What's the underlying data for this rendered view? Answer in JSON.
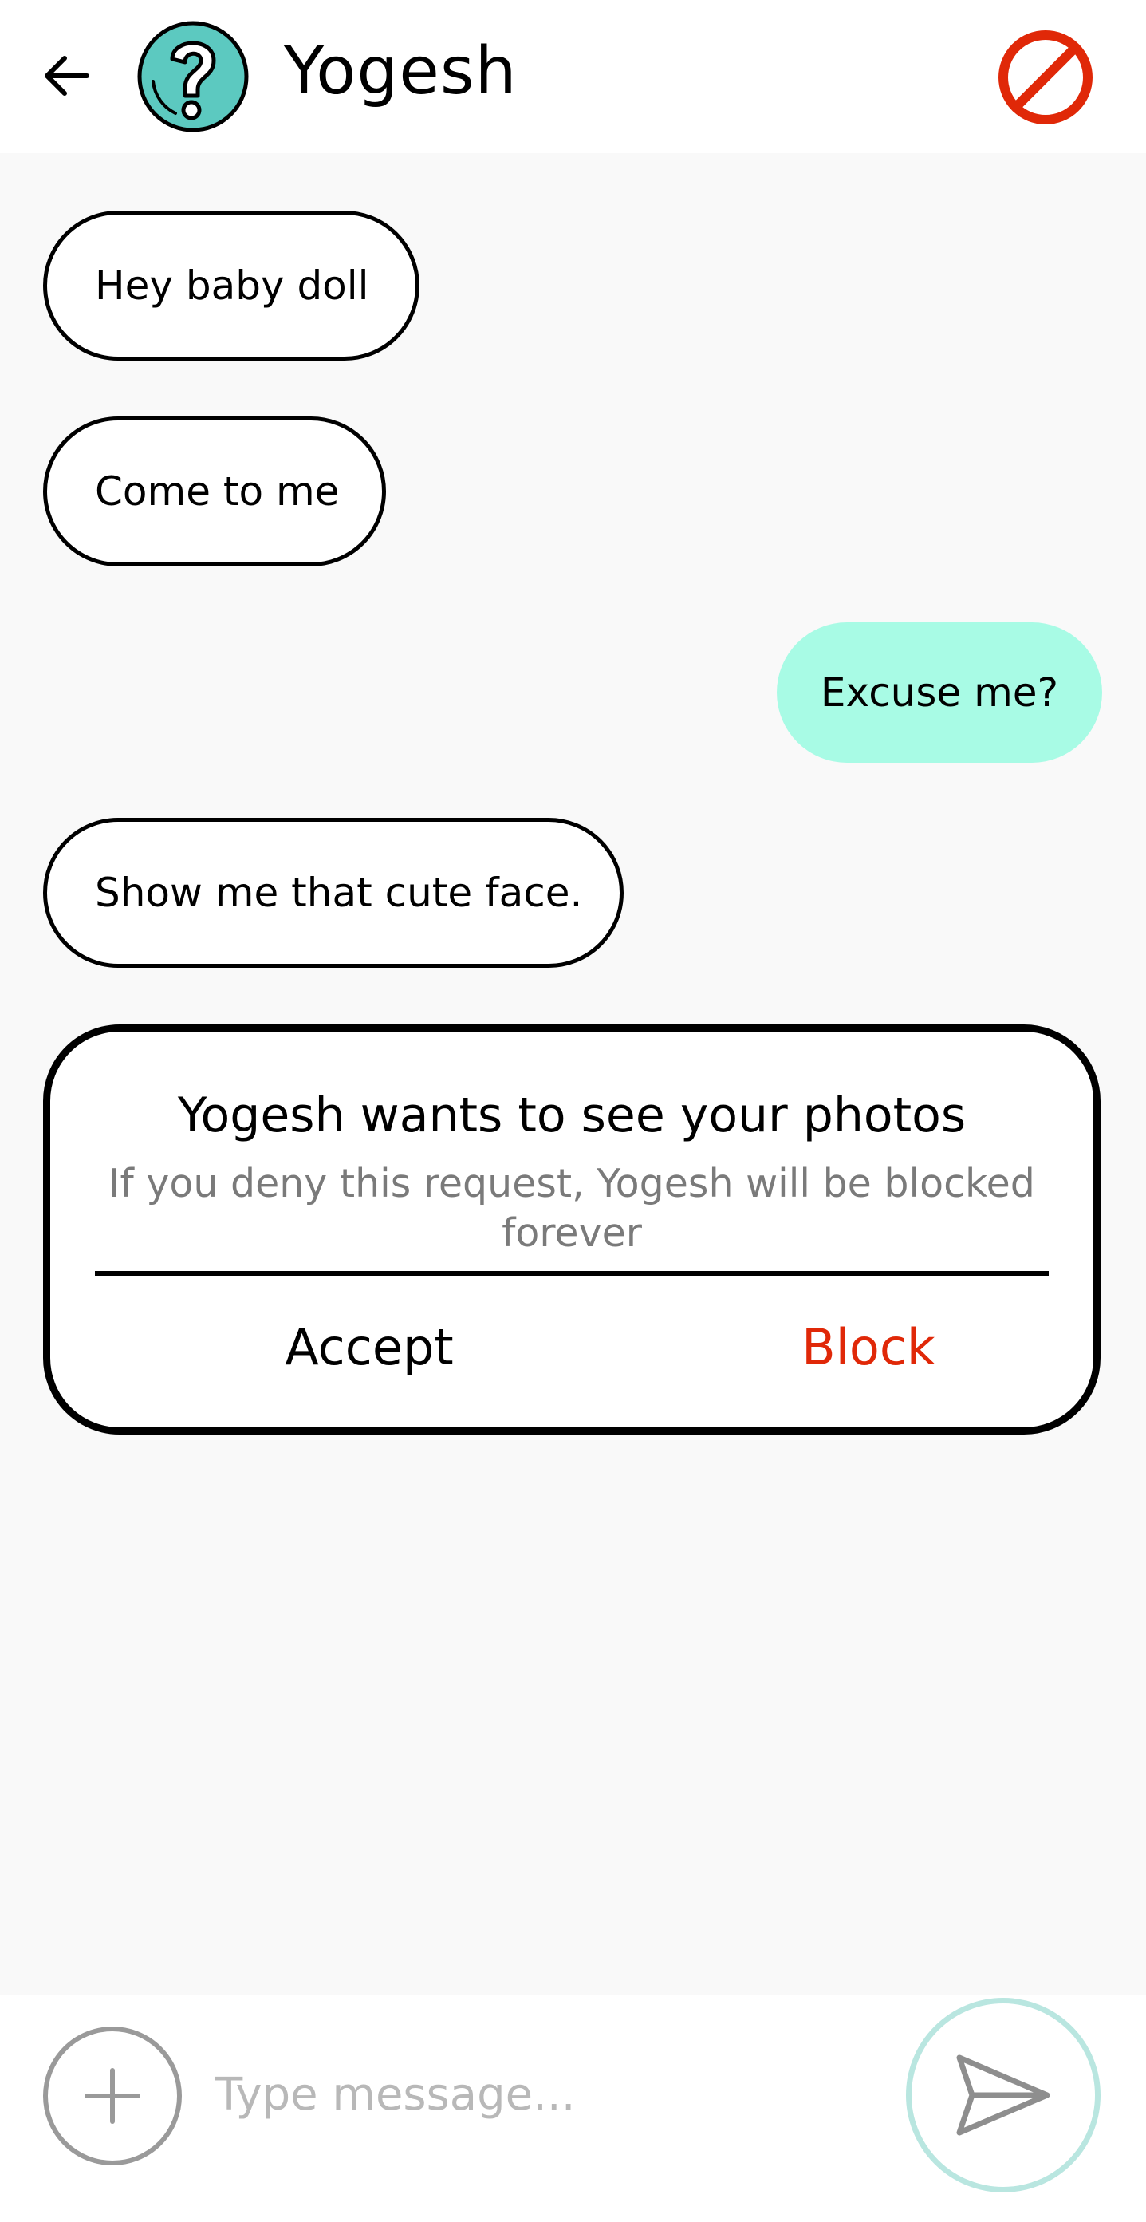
{
  "header": {
    "contact_name": "Yogesh"
  },
  "messages": [
    {
      "direction": "in",
      "text": "Hey baby doll"
    },
    {
      "direction": "in",
      "text": "Come to me"
    },
    {
      "direction": "out",
      "text": "Excuse me?"
    },
    {
      "direction": "in",
      "text": "Show me that cute face."
    }
  ],
  "request": {
    "title": "Yogesh wants to see your photos",
    "subtitle": "If you deny this request, Yogesh will be blocked forever",
    "accept_label": "Accept",
    "block_label": "Block"
  },
  "composer": {
    "placeholder": "Type message..."
  },
  "colors": {
    "outgoing_bubble": "#a8fbe5",
    "block_red": "#e02808",
    "avatar_teal": "#5cc9c0",
    "send_ring": "#b9e6e0"
  },
  "icons": {
    "back": "arrow-left-icon",
    "avatar": "question-mark-avatar-icon",
    "block": "prohibited-icon",
    "add": "plus-icon",
    "send": "paper-plane-icon"
  }
}
